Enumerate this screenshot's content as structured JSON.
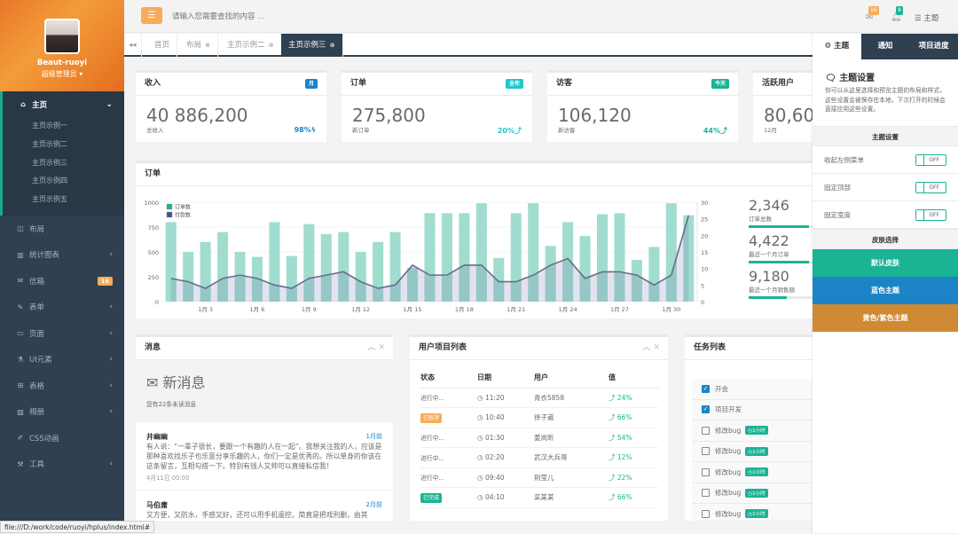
{
  "profile": {
    "name": "Beaut-ruoyi",
    "role": "超级管理员"
  },
  "nav": {
    "home": "主页",
    "sub": [
      "主页示例一",
      "主页示例二",
      "主页示例三",
      "主页示例四",
      "主页示例五"
    ],
    "items": [
      {
        "icon": "◫",
        "label": "布局",
        "name": "layout"
      },
      {
        "icon": "▥",
        "label": "统计图表",
        "name": "charts",
        "arrow": true
      },
      {
        "icon": "✉",
        "label": "信箱",
        "name": "mailbox",
        "badge": "16"
      },
      {
        "icon": "✎",
        "label": "表单",
        "name": "forms",
        "arrow": true
      },
      {
        "icon": "▭",
        "label": "页面",
        "name": "pages",
        "arrow": true
      },
      {
        "icon": "⚗",
        "label": "UI元素",
        "name": "ui-elements",
        "arrow": true
      },
      {
        "icon": "⊞",
        "label": "表格",
        "name": "tables",
        "arrow": true
      },
      {
        "icon": "▨",
        "label": "相册",
        "name": "album",
        "arrow": true
      },
      {
        "icon": "✐",
        "label": "CSS动画",
        "name": "css-animation"
      },
      {
        "icon": "⚒",
        "label": "工具",
        "name": "tools",
        "arrow": true
      }
    ]
  },
  "topbar": {
    "search_placeholder": "请输入您需要查找的内容 …",
    "mail_count": "16",
    "bell_count": "8",
    "theme_label": "主题"
  },
  "tabs": [
    "首页",
    "布局",
    "主页示例二",
    "主页示例三"
  ],
  "stats": [
    {
      "title": "收入",
      "label": "月",
      "label_color": "#1c84c6",
      "value": "40 886,200",
      "sub": "总收入",
      "pct": "98%",
      "pct_icon": "ϟ",
      "pct_color": "#1c84c6"
    },
    {
      "title": "订单",
      "label": "全年",
      "label_color": "#23c6c8",
      "value": "275,800",
      "sub": "新订单",
      "pct": "20%",
      "pct_icon": "⤴",
      "pct_color": "#23c6c8"
    },
    {
      "title": "访客",
      "label": "今天",
      "label_color": "#1ab394",
      "value": "106,120",
      "sub": "新访客",
      "pct": "44%",
      "pct_icon": "⤴",
      "pct_color": "#1ab394"
    },
    {
      "title": "活跃用户",
      "label": "",
      "label_color": "",
      "value": "80,600",
      "sub": "12月",
      "pct": "",
      "pct_icon": "",
      "pct_color": ""
    }
  ],
  "orders_panel": {
    "title": "订单",
    "stats": [
      {
        "value": "2,346",
        "label": "订单总数",
        "progress": 0.95
      },
      {
        "value": "4,422",
        "label": "最近一个月订单",
        "progress": 0.95
      },
      {
        "value": "9,180",
        "label": "最近一个月销售额",
        "progress": 0.6
      }
    ]
  },
  "chart_data": {
    "type": "bar",
    "legend": [
      "订单数",
      "付款数"
    ],
    "x_ticks": [
      "1月 3",
      "1月 6",
      "1月 9",
      "1月 12",
      "1月 15",
      "1月 18",
      "1月 21",
      "1月 24",
      "1月 27",
      "1月 30"
    ],
    "y_left_ticks": [
      "0",
      "250",
      "500",
      "750",
      "1000"
    ],
    "y_right_ticks": [
      "0",
      "5",
      "10",
      "15",
      "20",
      "25",
      "30"
    ],
    "ylim_left": [
      0,
      1000
    ],
    "ylim_right": [
      0,
      30
    ],
    "days": [
      1,
      2,
      3,
      4,
      5,
      6,
      7,
      8,
      9,
      10,
      11,
      12,
      13,
      14,
      15,
      16,
      17,
      18,
      19,
      20,
      21,
      22,
      23,
      24,
      25,
      26,
      27,
      28,
      29,
      30,
      31
    ],
    "series": [
      {
        "name": "订单数",
        "axis": "left",
        "values": [
          800,
          500,
          600,
          700,
          500,
          450,
          800,
          460,
          780,
          680,
          700,
          500,
          600,
          700,
          340,
          890,
          890,
          890,
          990,
          440,
          890,
          990,
          560,
          800,
          660,
          880,
          890,
          420,
          550,
          990,
          870
        ]
      },
      {
        "name": "付款数",
        "axis": "right",
        "values": [
          7,
          6,
          4,
          7,
          8,
          7,
          5,
          4,
          7,
          8,
          9,
          6,
          4,
          5,
          11,
          8,
          8,
          11,
          11,
          6,
          6,
          8,
          11,
          13,
          7,
          9,
          9,
          8,
          5,
          8,
          26
        ]
      }
    ]
  },
  "messages": {
    "title": "消息",
    "header": "新消息",
    "count_text": "您有22条未读消息",
    "items": [
      {
        "name": "井幽幽",
        "date": "1月前",
        "text": "有人说：“一辈子很长，要跟一个有趣的人在一起”。我想关注我的人，应该是那种喜欢找乐子也乐意分享乐趣的人，你们一定是优秀的。所以单身的你该在这条留言，互相勾搭一下。特别有钱人又帅可以直接私信我！",
        "time": "4月11日 00:00"
      },
      {
        "name": "马伯庸",
        "date": "2月前",
        "text": "又方便，又防水，手感又好，还可以用手机遥控。简直是把戏刑删，由其",
        "time": ""
      }
    ]
  },
  "projects": {
    "title": "用户项目列表",
    "headers": [
      "状态",
      "日期",
      "用户",
      "值"
    ],
    "rows": [
      {
        "status": "进行中...",
        "status_color": "",
        "date": "11:20",
        "user": "青衣5858",
        "val": "24%"
      },
      {
        "status": "已取消",
        "status_color": "#f8ac59",
        "date": "10:40",
        "user": "徐子崴",
        "val": "66%"
      },
      {
        "status": "进行中...",
        "status_color": "",
        "date": "01:30",
        "user": "姜岚昕",
        "val": "54%"
      },
      {
        "status": "进行中...",
        "status_color": "",
        "date": "02:20",
        "user": "武汉大兵哥",
        "val": "12%"
      },
      {
        "status": "进行中...",
        "status_color": "",
        "date": "09:40",
        "user": "荆莹儿",
        "val": "22%"
      },
      {
        "status": "已完成",
        "status_color": "#1ab394",
        "date": "04:10",
        "user": "栾某某",
        "val": "66%"
      }
    ]
  },
  "tasks": {
    "title": "任务列表",
    "items": [
      {
        "label": "开会",
        "checked": true,
        "tag": ""
      },
      {
        "label": "项目开发",
        "checked": true,
        "tag": ""
      },
      {
        "label": "修改bug",
        "checked": false,
        "tag": "1小时"
      },
      {
        "label": "修改bug",
        "checked": false,
        "tag": "1小时"
      },
      {
        "label": "修改bug",
        "checked": false,
        "tag": "1小时"
      },
      {
        "label": "修改bug",
        "checked": false,
        "tag": "1小时"
      },
      {
        "label": "修改bug",
        "checked": false,
        "tag": "1小时"
      }
    ]
  },
  "right_panel": {
    "tabs": [
      "主题",
      "通知",
      "项目进度"
    ],
    "heading": "主题设置",
    "desc": "你可以从这里选择和预览主题的布局和样式，这些设置会被保存在本地，下次打开的时候会直接应用这些设置。",
    "section1": "主题设置",
    "options": [
      {
        "label": "收起左侧菜单",
        "state": "OFF"
      },
      {
        "label": "固定顶部",
        "state": "OFF"
      },
      {
        "label": "固定宽度",
        "state": "OFF"
      }
    ],
    "section2": "皮肤选择",
    "skins": [
      {
        "label": "默认皮肤",
        "color": "#1ab394"
      },
      {
        "label": "蓝色主题",
        "color": "#1c84c6"
      },
      {
        "label": "黄色/紫色主题",
        "color": "#d08a33"
      }
    ]
  },
  "statusbar": "file:///D:/work/code/ruoyi/hplus/index.html#"
}
